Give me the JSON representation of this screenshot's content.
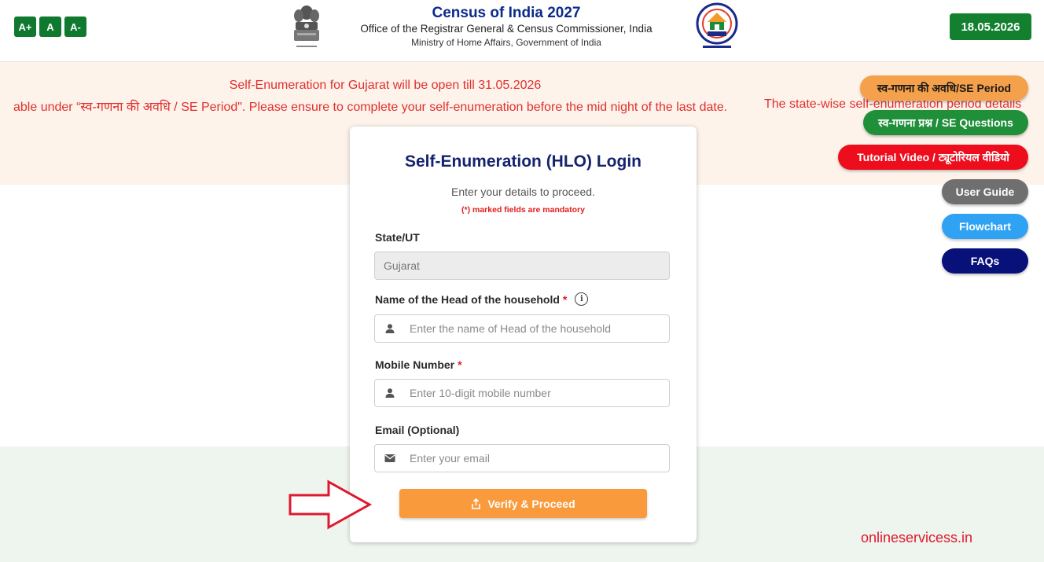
{
  "header": {
    "font_controls": [
      "A+",
      "A",
      "A-"
    ],
    "title": "Census of India 2027",
    "subtitle": "Office of the Registrar General & Census Commissioner, India",
    "ministry": "Ministry of Home Affairs, Government of India",
    "date": "18.05.2026"
  },
  "notice": {
    "line1": "Self-Enumeration for Gujarat will be open till 31.05.2026",
    "ticker_part1": "able under “स्व-गणना की अवधि / SE Period\". Please ensure to complete your self-enumeration before the mid night of the last date.",
    "ticker_part2": "The state-wise self-enumeration period details"
  },
  "side_buttons": {
    "period": "स्व-गणना की अवधि/SE Period",
    "questions": "स्व-गणना प्रश्न / SE Questions",
    "video": "Tutorial Video / ट्यूटोरियल वीडियो",
    "guide": "User Guide",
    "flowchart": "Flowchart",
    "faqs": "FAQs"
  },
  "form": {
    "title": "Self-Enumeration (HLO) Login",
    "subtitle": "Enter your details to proceed.",
    "mandatory_note": "(*) marked fields are mandatory",
    "state_label": "State/UT",
    "state_value": "Gujarat",
    "head_label": "Name of the Head of the household",
    "head_placeholder": "Enter the name of Head of the household",
    "mobile_label": "Mobile Number",
    "mobile_placeholder": "Enter 10-digit mobile number",
    "email_label": "Email (Optional)",
    "email_placeholder": "Enter your email",
    "required_mark": "*",
    "verify_label": "Verify & Proceed"
  },
  "watermark": "onlineservicess.in",
  "colors": {
    "header_green": "#12802f",
    "title_navy": "#0b2a8a",
    "notice_red": "#e12f2f",
    "button_orange": "#f99a3c"
  }
}
